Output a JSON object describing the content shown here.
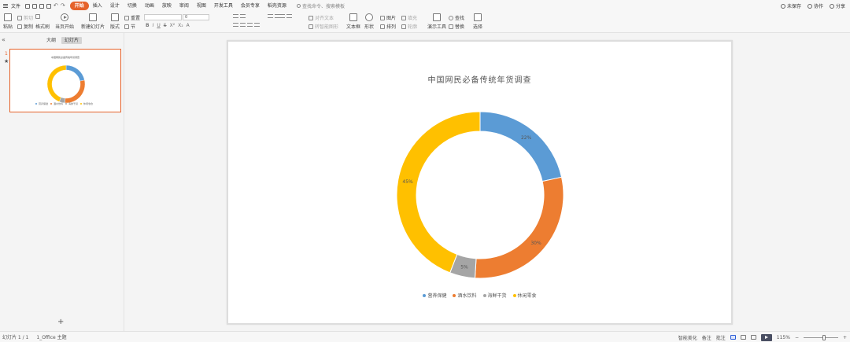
{
  "menubar": {
    "file_label": "文件",
    "tabs": [
      "开始",
      "插入",
      "设计",
      "切换",
      "动画",
      "放映",
      "审阅",
      "视图",
      "开发工具",
      "会员专享",
      "稻壳资源"
    ],
    "active_tab": "开始",
    "search_placeholder": "查找命令、搜索模板",
    "unsaved_label": "未保存",
    "collab_label": "协作",
    "share_label": "分享"
  },
  "ribbon": {
    "paste": "粘贴",
    "cut": "剪切",
    "copy": "复制",
    "format_painter": "格式刷",
    "play_from_current": "当页开始",
    "new_slide": "新建幻灯片",
    "layout": "版式",
    "section": "节",
    "reset": "重置",
    "font_name": "",
    "font_size": "0",
    "align_text": "对齐文本",
    "convert_smartart": "转智能图形",
    "textbox": "文本框",
    "shape": "形状",
    "arrange": "排列",
    "picture": "图片",
    "fill": "填充",
    "outline": "轮廓",
    "presenter_tools": "演示工具",
    "find": "查找",
    "replace": "替换",
    "select": "选择"
  },
  "left_panel": {
    "tab_outline": "大纲",
    "tab_slides": "幻灯片",
    "slide_number": "1",
    "add_slide": "+"
  },
  "status": {
    "slide_position": "幻灯片 1 / 1",
    "theme": "1_Office 主题",
    "smart_beautify": "智能美化",
    "notes": "备注",
    "comments": "批注",
    "zoom": "115%"
  },
  "colors": {
    "accent": "#e5622a",
    "series": [
      "#5b9bd5",
      "#ed7d31",
      "#a5a5a5",
      "#ffc000"
    ]
  },
  "chart_data": {
    "type": "pie",
    "donut": true,
    "title": "中国网民必备传统年货调查",
    "categories": [
      "营养保健",
      "酒水饮料",
      "海鲜干货",
      "休闲零食"
    ],
    "values": [
      22,
      30,
      5,
      45
    ],
    "labels": [
      "22%",
      "30%",
      "5%",
      "45%"
    ],
    "legend_position": "bottom"
  }
}
